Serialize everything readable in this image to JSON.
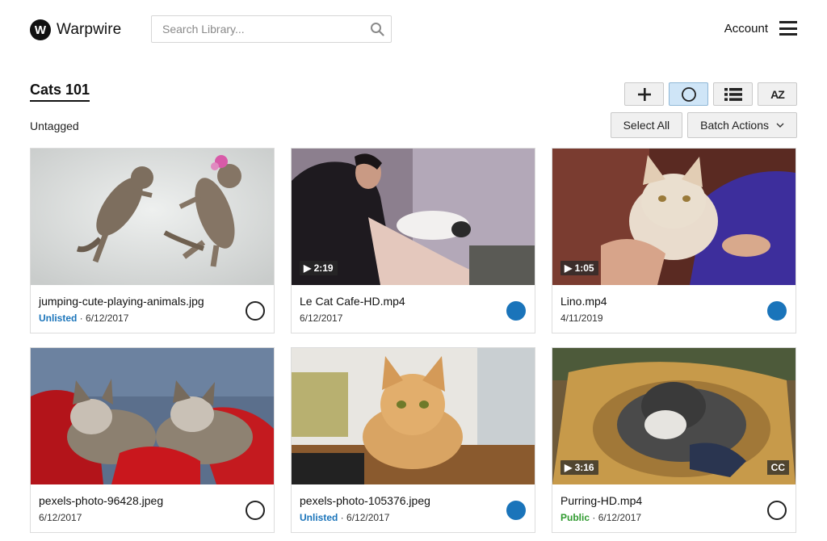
{
  "header": {
    "logo_mark": "W",
    "logo_text": "Warpwire",
    "search_placeholder": "Search Library...",
    "account_label": "Account"
  },
  "library": {
    "title": "Cats 101",
    "tag": "Untagged",
    "toolbar": {
      "add_icon": "plus-icon",
      "select_mode_icon": "circle-icon",
      "list_view_icon": "list-icon",
      "sort_label": "AZ"
    },
    "select_all_label": "Select All",
    "batch_actions_label": "Batch Actions"
  },
  "colors": {
    "accent": "#1a74ba",
    "unlisted": "#1a74ba",
    "public": "#2f9a2f",
    "toolbar_active": "#cfe5f7"
  },
  "items": [
    {
      "filename": "jumping-cute-playing-animals.jpg",
      "status": "Unlisted",
      "date": "6/12/2017",
      "duration": "",
      "cc": "",
      "selected": false
    },
    {
      "filename": "Le Cat Cafe-HD.mp4",
      "status": "",
      "date": "6/12/2017",
      "duration": "2:19",
      "cc": "",
      "selected": true
    },
    {
      "filename": "Lino.mp4",
      "status": "",
      "date": "4/11/2019",
      "duration": "1:05",
      "cc": "",
      "selected": true
    },
    {
      "filename": "pexels-photo-96428.jpeg",
      "status": "",
      "date": "6/12/2017",
      "duration": "",
      "cc": "",
      "selected": false
    },
    {
      "filename": "pexels-photo-105376.jpeg",
      "status": "Unlisted",
      "date": "6/12/2017",
      "duration": "",
      "cc": "",
      "selected": true
    },
    {
      "filename": "Purring-HD.mp4",
      "status": "Public",
      "date": "6/12/2017",
      "duration": "3:16",
      "cc": "CC",
      "selected": false
    }
  ]
}
